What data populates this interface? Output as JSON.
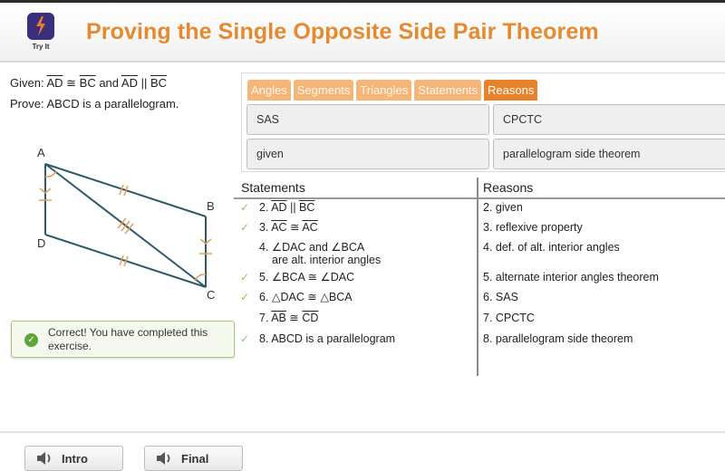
{
  "header": {
    "logo_label": "Try It",
    "title": "Proving the Single Opposite Side Pair Theorem"
  },
  "problem": {
    "given_prefix": "Given: ",
    "given_seg1": "AD",
    "given_cong": " ≅ ",
    "given_seg2": "BC",
    "given_and": " and ",
    "given_seg3": "AD",
    "given_par": " || ",
    "given_seg4": "BC",
    "prove": "Prove: ABCD is a parallelogram."
  },
  "figure": {
    "labels": {
      "A": "A",
      "B": "B",
      "C": "C",
      "D": "D"
    },
    "line_color": "#2f5b68",
    "mark_color": "#e0a05a"
  },
  "feedback": {
    "message": "Correct! You have completed this exercise.",
    "icon": "check-circle-icon",
    "status_color": "#5ea63a"
  },
  "bank": {
    "tabs": [
      {
        "label": "Angles",
        "active": false
      },
      {
        "label": "Segments",
        "active": false
      },
      {
        "label": "Triangles",
        "active": false
      },
      {
        "label": "Statements",
        "active": false
      },
      {
        "label": "Reasons",
        "active": true
      }
    ],
    "tiles": [
      "SAS",
      "CPCTC",
      "given",
      "parallelogram side theorem"
    ]
  },
  "proof": {
    "statements_header": "Statements",
    "reasons_header": "Reasons",
    "rows": [
      {
        "checked": true,
        "num": "2. ",
        "s1": "AD",
        "op": " || ",
        "s2": "BC",
        "reason": "2. given"
      },
      {
        "checked": true,
        "num": "3. ",
        "s1": "AC",
        "op": " ≅ ",
        "s2": "AC",
        "reason": "3. reflexive property"
      },
      {
        "checked": false,
        "text": "4. ∠DAC and ∠BCA",
        "text2": "are alt. interior angles",
        "reason": "4. def. of alt. interior angles"
      },
      {
        "checked": true,
        "text": "5. ∠BCA ≅ ∠DAC",
        "reason": "5. alternate interior angles theorem"
      },
      {
        "checked": true,
        "text": "6. △DAC ≅ △BCA",
        "reason": "6. SAS"
      },
      {
        "checked": false,
        "num": "7. ",
        "s1": "AB",
        "op": " ≅ ",
        "s2": "CD",
        "reason": "7. CPCTC"
      },
      {
        "checked": true,
        "text": "8. ABCD is a parallelogram",
        "reason": "8. parallelogram side theorem"
      }
    ],
    "check_glyph": "✓"
  },
  "footer": {
    "intro_label": "Intro",
    "final_label": "Final"
  }
}
